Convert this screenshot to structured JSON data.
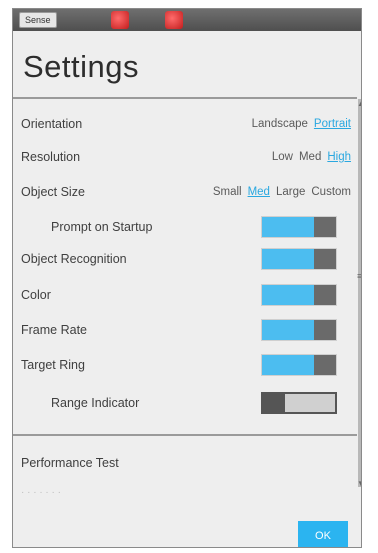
{
  "window": {
    "title_tag": "Sense"
  },
  "header": {
    "title": "Settings"
  },
  "settings": {
    "orientation": {
      "label": "Orientation",
      "options": [
        "Landscape",
        "Portrait"
      ],
      "selected": "Portrait"
    },
    "resolution": {
      "label": "Resolution",
      "options": [
        "Low",
        "Med",
        "High"
      ],
      "selected": "High"
    },
    "object_size": {
      "label": "Object Size",
      "options": [
        "Small",
        "Med",
        "Large",
        "Custom"
      ],
      "selected": "Med"
    },
    "prompt_on_startup": {
      "label": "Prompt on Startup",
      "on": true
    },
    "object_recognition": {
      "label": "Object Recognition",
      "on": true
    },
    "color": {
      "label": "Color",
      "on": true
    },
    "frame_rate": {
      "label": "Frame Rate",
      "on": true
    },
    "target_ring": {
      "label": "Target Ring",
      "on": true
    },
    "range_indicator": {
      "label": "Range Indicator",
      "on": false
    }
  },
  "footer": {
    "performance_test": "Performance Test",
    "ok": "OK"
  },
  "colors": {
    "accent": "#2bb4f0",
    "toggle_on": "#4cbdf0",
    "knob": "#6a6a6a"
  }
}
